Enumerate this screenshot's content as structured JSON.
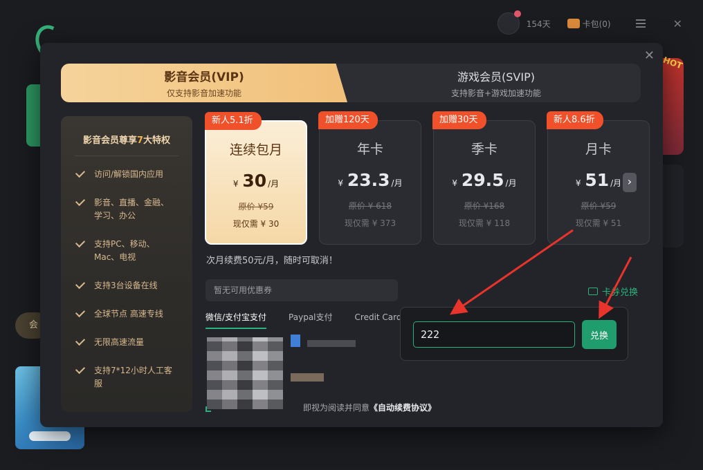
{
  "app": {
    "days_label": "154天",
    "wallet_label": "卡包(0)",
    "side_pill": "会"
  },
  "modal": {
    "tabs": [
      {
        "title": "影音会员(VIP)",
        "subtitle": "仅支持影音加速功能"
      },
      {
        "title": "游戏会员(SVIP)",
        "subtitle": "支持影音+游戏加速功能"
      }
    ],
    "privileges": {
      "title_prefix": "影音会员尊享",
      "title_num": "7",
      "title_suffix": "大特权",
      "items": [
        "访问/解锁国内应用",
        "影音、直播、金融、学习、办公",
        "支持PC、移动、Mac、电视",
        "支持3台设备在线",
        "全球节点 高速专线",
        "无限高速流量",
        "支持7*12小时人工客服"
      ]
    },
    "plans": [
      {
        "badge": "新人5.1折",
        "name": "连续包月",
        "currency": "¥",
        "amount": "30",
        "unit": "/月",
        "original": "原价 ¥59",
        "now": "现仅需 ¥ 30"
      },
      {
        "badge": "加赠120天",
        "name": "年卡",
        "currency": "¥",
        "amount": "23.3",
        "unit": "/月",
        "original": "原价 ¥ 618",
        "now": "现仅需 ¥ 373"
      },
      {
        "badge": "加赠30天",
        "name": "季卡",
        "currency": "¥",
        "amount": "29.5",
        "unit": "/月",
        "original": "原价 ¥168",
        "now": "现仅需 ¥ 118"
      },
      {
        "badge": "新人8.6折",
        "name": "月卡",
        "currency": "¥",
        "amount": "51",
        "unit": "/月",
        "original": "原价 ¥59",
        "now": "现仅需 ¥ 51"
      }
    ],
    "renew_note": "次月续费50元/月，随时可取消！",
    "coupon_text": "暂无可用优惠券",
    "card_exchange": "卡券兑换",
    "pay_tabs": [
      "微信/支付宝支付",
      "Paypal支付",
      "Credit Card支付"
    ],
    "agree_prefix": "即视为阅读并同意",
    "agree_link": "《自动续费协议》"
  },
  "exchange": {
    "code_value": "222",
    "redeem_label": "兑换"
  },
  "colors": {
    "accent_green": "#2ab37b",
    "gold": "#f3c988",
    "badge_red": "#f0512b",
    "annotation_red": "#e8342b"
  }
}
